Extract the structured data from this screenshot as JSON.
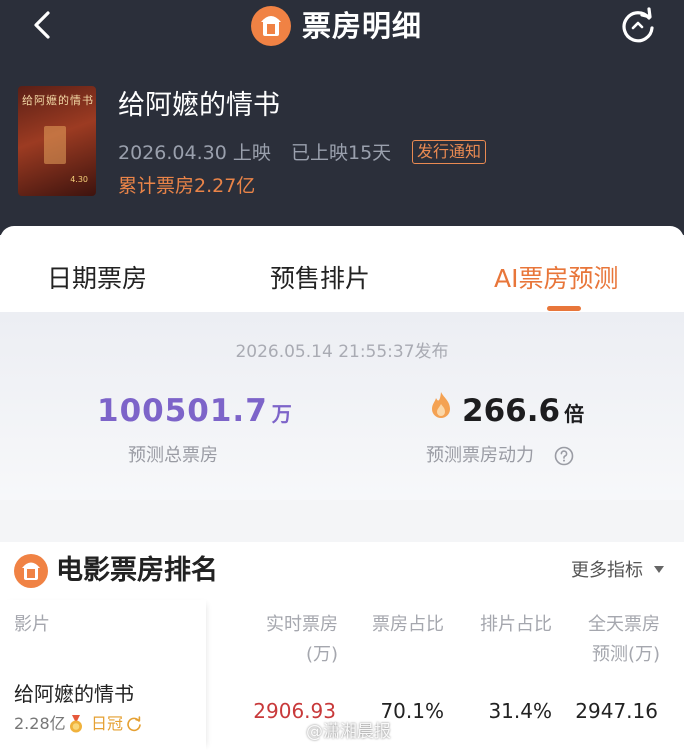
{
  "header": {
    "title": "票房明细",
    "back_icon": "chevron-left-icon",
    "refresh_icon": "refresh-icon"
  },
  "movie": {
    "poster_title": "给阿嬷的情书",
    "poster_date": "4.30",
    "name": "给阿嬷的情书",
    "release_date": "2026.04.30 上映",
    "days_shown": "已上映15天",
    "notice_badge": "发行通知",
    "total_box_office": "累计票房2.27亿"
  },
  "tabs": [
    {
      "label": "日期票房"
    },
    {
      "label": "预售排片"
    },
    {
      "label": "AI票房预测",
      "active": true
    }
  ],
  "forecast": {
    "publish_time": "2026.05.14 21:55:37发布",
    "total_value": "100501.7",
    "total_unit": "万",
    "total_label": "预测总票房",
    "power_value": "266.6",
    "power_unit": "倍",
    "power_label": "预测票房动力"
  },
  "ranking": {
    "title": "电影票房排名",
    "more_metrics": "更多指标",
    "columns": {
      "film": "影片",
      "realtime": "实时票房\n(万)",
      "box_share": "票房占比",
      "schedule_share": "排片占比",
      "fullday": "全天票房\n预测(万)"
    },
    "rows": [
      {
        "name": "给阿嬷的情书",
        "total": "2.28亿",
        "badge": "日冠",
        "realtime": "2906.93",
        "box_share": "70.1%",
        "schedule_share": "31.4%",
        "fullday": "2947.16"
      }
    ]
  },
  "watermark": "@潇湘晨报",
  "colors": {
    "header_bg": "#2b2f3a",
    "accent_orange": "#e8763a",
    "forecast_purple": "#7d64c9",
    "realtime_red": "#c8393a"
  }
}
